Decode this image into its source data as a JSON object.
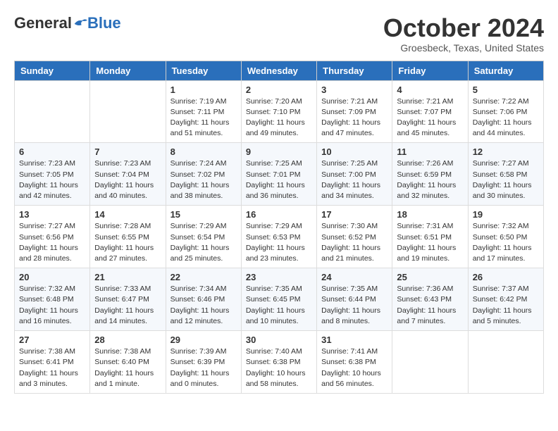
{
  "header": {
    "logo_general": "General",
    "logo_blue": "Blue",
    "month_title": "October 2024",
    "subtitle": "Groesbeck, Texas, United States"
  },
  "weekdays": [
    "Sunday",
    "Monday",
    "Tuesday",
    "Wednesday",
    "Thursday",
    "Friday",
    "Saturday"
  ],
  "weeks": [
    [
      {
        "day": "",
        "info": ""
      },
      {
        "day": "",
        "info": ""
      },
      {
        "day": "1",
        "info": "Sunrise: 7:19 AM\nSunset: 7:11 PM\nDaylight: 11 hours and 51 minutes."
      },
      {
        "day": "2",
        "info": "Sunrise: 7:20 AM\nSunset: 7:10 PM\nDaylight: 11 hours and 49 minutes."
      },
      {
        "day": "3",
        "info": "Sunrise: 7:21 AM\nSunset: 7:09 PM\nDaylight: 11 hours and 47 minutes."
      },
      {
        "day": "4",
        "info": "Sunrise: 7:21 AM\nSunset: 7:07 PM\nDaylight: 11 hours and 45 minutes."
      },
      {
        "day": "5",
        "info": "Sunrise: 7:22 AM\nSunset: 7:06 PM\nDaylight: 11 hours and 44 minutes."
      }
    ],
    [
      {
        "day": "6",
        "info": "Sunrise: 7:23 AM\nSunset: 7:05 PM\nDaylight: 11 hours and 42 minutes."
      },
      {
        "day": "7",
        "info": "Sunrise: 7:23 AM\nSunset: 7:04 PM\nDaylight: 11 hours and 40 minutes."
      },
      {
        "day": "8",
        "info": "Sunrise: 7:24 AM\nSunset: 7:02 PM\nDaylight: 11 hours and 38 minutes."
      },
      {
        "day": "9",
        "info": "Sunrise: 7:25 AM\nSunset: 7:01 PM\nDaylight: 11 hours and 36 minutes."
      },
      {
        "day": "10",
        "info": "Sunrise: 7:25 AM\nSunset: 7:00 PM\nDaylight: 11 hours and 34 minutes."
      },
      {
        "day": "11",
        "info": "Sunrise: 7:26 AM\nSunset: 6:59 PM\nDaylight: 11 hours and 32 minutes."
      },
      {
        "day": "12",
        "info": "Sunrise: 7:27 AM\nSunset: 6:58 PM\nDaylight: 11 hours and 30 minutes."
      }
    ],
    [
      {
        "day": "13",
        "info": "Sunrise: 7:27 AM\nSunset: 6:56 PM\nDaylight: 11 hours and 28 minutes."
      },
      {
        "day": "14",
        "info": "Sunrise: 7:28 AM\nSunset: 6:55 PM\nDaylight: 11 hours and 27 minutes."
      },
      {
        "day": "15",
        "info": "Sunrise: 7:29 AM\nSunset: 6:54 PM\nDaylight: 11 hours and 25 minutes."
      },
      {
        "day": "16",
        "info": "Sunrise: 7:29 AM\nSunset: 6:53 PM\nDaylight: 11 hours and 23 minutes."
      },
      {
        "day": "17",
        "info": "Sunrise: 7:30 AM\nSunset: 6:52 PM\nDaylight: 11 hours and 21 minutes."
      },
      {
        "day": "18",
        "info": "Sunrise: 7:31 AM\nSunset: 6:51 PM\nDaylight: 11 hours and 19 minutes."
      },
      {
        "day": "19",
        "info": "Sunrise: 7:32 AM\nSunset: 6:50 PM\nDaylight: 11 hours and 17 minutes."
      }
    ],
    [
      {
        "day": "20",
        "info": "Sunrise: 7:32 AM\nSunset: 6:48 PM\nDaylight: 11 hours and 16 minutes."
      },
      {
        "day": "21",
        "info": "Sunrise: 7:33 AM\nSunset: 6:47 PM\nDaylight: 11 hours and 14 minutes."
      },
      {
        "day": "22",
        "info": "Sunrise: 7:34 AM\nSunset: 6:46 PM\nDaylight: 11 hours and 12 minutes."
      },
      {
        "day": "23",
        "info": "Sunrise: 7:35 AM\nSunset: 6:45 PM\nDaylight: 11 hours and 10 minutes."
      },
      {
        "day": "24",
        "info": "Sunrise: 7:35 AM\nSunset: 6:44 PM\nDaylight: 11 hours and 8 minutes."
      },
      {
        "day": "25",
        "info": "Sunrise: 7:36 AM\nSunset: 6:43 PM\nDaylight: 11 hours and 7 minutes."
      },
      {
        "day": "26",
        "info": "Sunrise: 7:37 AM\nSunset: 6:42 PM\nDaylight: 11 hours and 5 minutes."
      }
    ],
    [
      {
        "day": "27",
        "info": "Sunrise: 7:38 AM\nSunset: 6:41 PM\nDaylight: 11 hours and 3 minutes."
      },
      {
        "day": "28",
        "info": "Sunrise: 7:38 AM\nSunset: 6:40 PM\nDaylight: 11 hours and 1 minute."
      },
      {
        "day": "29",
        "info": "Sunrise: 7:39 AM\nSunset: 6:39 PM\nDaylight: 11 hours and 0 minutes."
      },
      {
        "day": "30",
        "info": "Sunrise: 7:40 AM\nSunset: 6:38 PM\nDaylight: 10 hours and 58 minutes."
      },
      {
        "day": "31",
        "info": "Sunrise: 7:41 AM\nSunset: 6:38 PM\nDaylight: 10 hours and 56 minutes."
      },
      {
        "day": "",
        "info": ""
      },
      {
        "day": "",
        "info": ""
      }
    ]
  ]
}
